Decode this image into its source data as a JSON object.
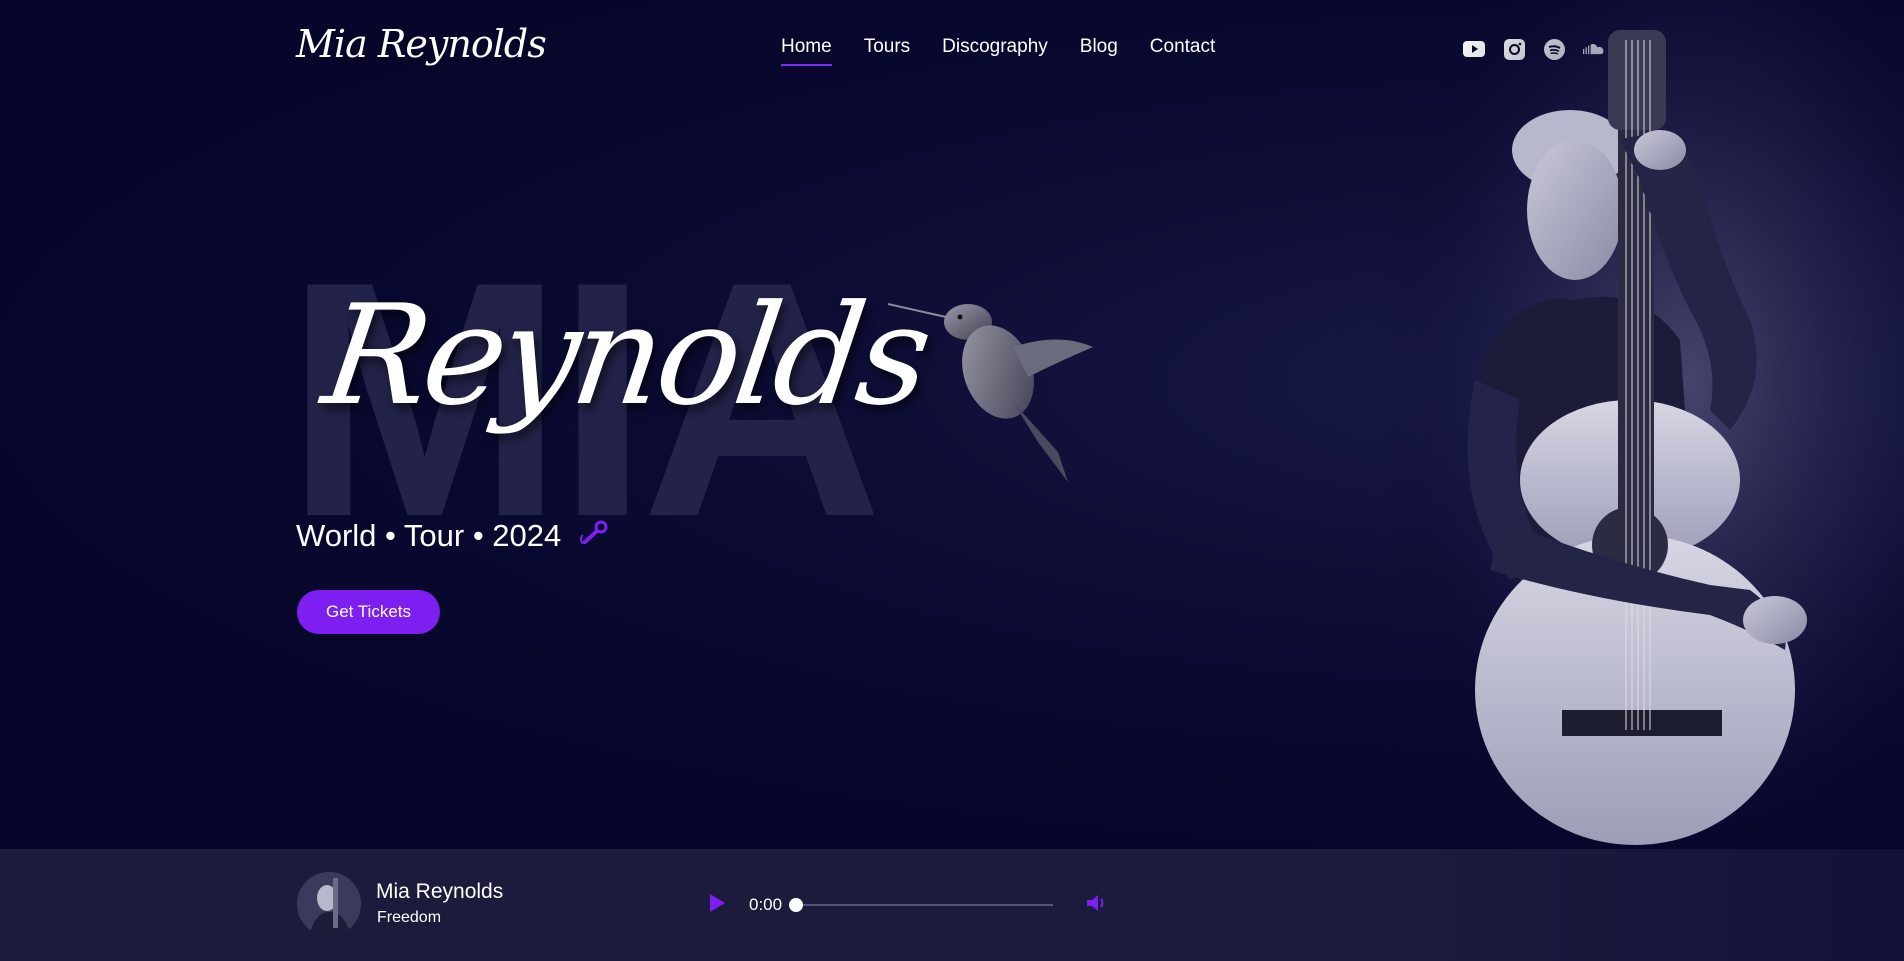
{
  "header": {
    "logo": "Mia Reynolds",
    "nav": [
      {
        "label": "Home",
        "active": true
      },
      {
        "label": "Tours",
        "active": false
      },
      {
        "label": "Discography",
        "active": false
      },
      {
        "label": "Blog",
        "active": false
      },
      {
        "label": "Contact",
        "active": false
      }
    ],
    "social": [
      "youtube-icon",
      "instagram-icon",
      "spotify-icon",
      "soundcloud-icon"
    ]
  },
  "hero": {
    "bg_word": "MIA",
    "script_name": "Reynolds",
    "tagline": "World • Tour • 2024",
    "tagline_icon": "microphone-icon",
    "cta_label": "Get Tickets"
  },
  "player": {
    "artist": "Mia Reynolds",
    "track": "Freedom",
    "time": "0:00",
    "progress": 0
  },
  "colors": {
    "background": "#06062a",
    "accent": "#7c1ff0",
    "bg_word": "#23234a",
    "player_bg": "#1b1b3c"
  }
}
